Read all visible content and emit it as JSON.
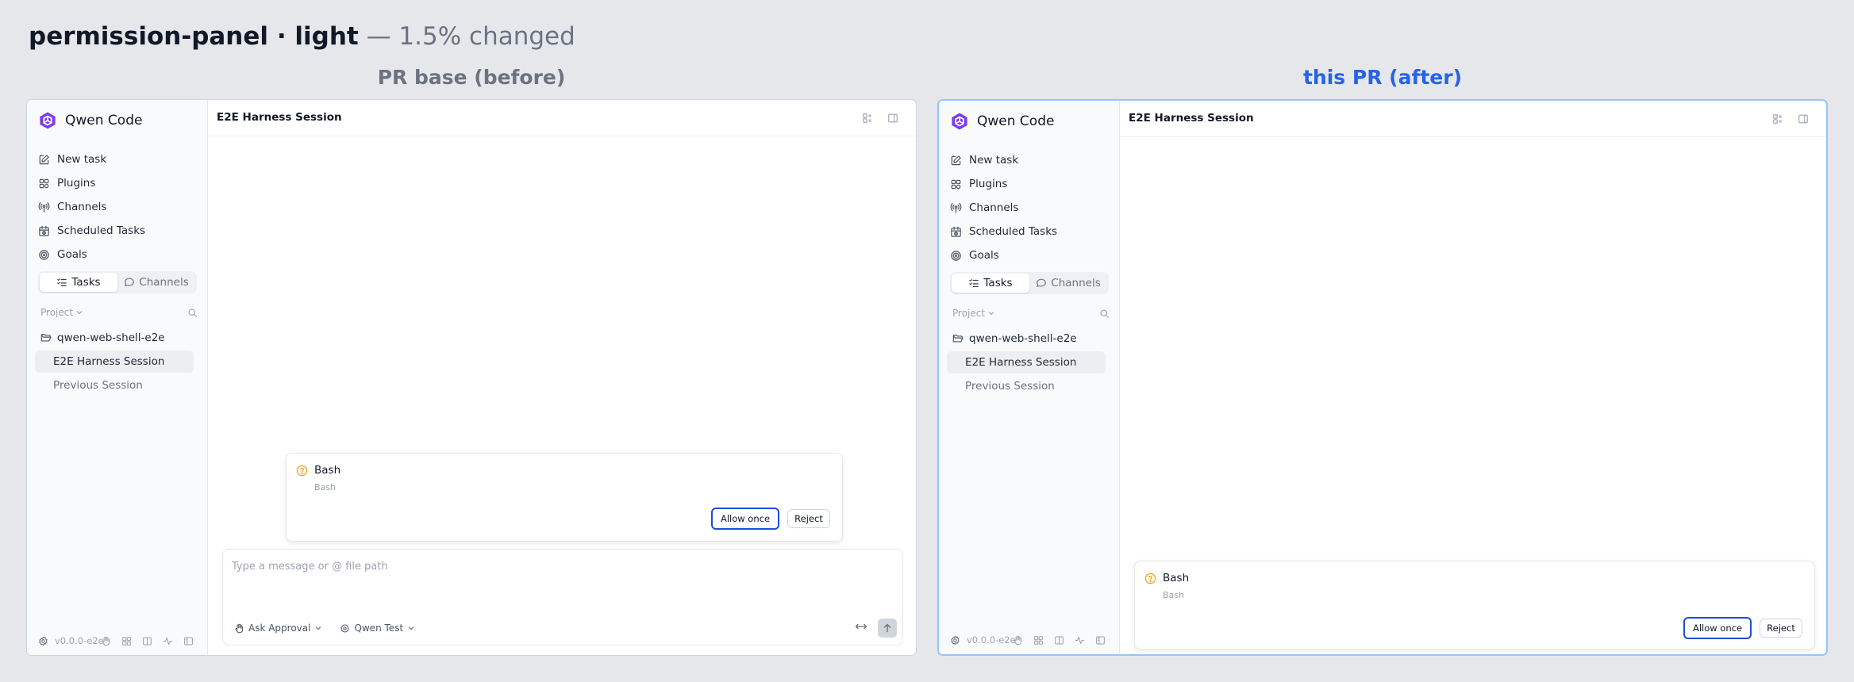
{
  "page_title": {
    "bold": "permission-panel · light",
    "light": " — 1.5% changed"
  },
  "panels": [
    {
      "label": "PR base (before)",
      "app_name": "Qwen Code",
      "nav": [
        "New task",
        "Plugins",
        "Channels",
        "Scheduled Tasks",
        "Goals"
      ],
      "tabs": [
        "Tasks",
        "Channels"
      ],
      "project_label": "Project",
      "folder": "qwen-web-shell-e2e",
      "sessions": [
        "E2E Harness Session",
        "Previous Session"
      ],
      "version": "v0.0.0-e2e",
      "session_title": "E2E Harness Session",
      "permission": {
        "title": "Bash",
        "subtitle": "Bash",
        "allow": "Allow once",
        "reject": "Reject"
      },
      "composer": {
        "placeholder": "Type a message or @ file path",
        "mode": "Ask Approval",
        "model": "Qwen Test"
      }
    },
    {
      "label": "this PR (after)",
      "app_name": "Qwen Code",
      "nav": [
        "New task",
        "Plugins",
        "Channels",
        "Scheduled Tasks",
        "Goals"
      ],
      "tabs": [
        "Tasks",
        "Channels"
      ],
      "project_label": "Project",
      "folder": "qwen-web-shell-e2e",
      "sessions": [
        "E2E Harness Session",
        "Previous Session"
      ],
      "version": "v0.0.0-e2e",
      "session_title": "E2E Harness Session",
      "permission": {
        "title": "Bash",
        "subtitle": "Bash",
        "allow": "Allow once",
        "reject": "Reject"
      }
    }
  ],
  "colors": {
    "accent_after": "#2563eb",
    "muted_before": "#6b7280",
    "allow_border": "#1d4ed8",
    "warning_icon": "#f59e0b",
    "logo": "#7c3aed"
  },
  "icons": {
    "nav": [
      "edit-icon",
      "puzzle-icon",
      "antenna-icon",
      "calendar-clock-icon",
      "target-icon"
    ],
    "tabs": [
      "task-list-icon",
      "chat-bubble-icon"
    ],
    "footer": [
      "settings-gear-icon",
      "hand-icon",
      "grid-icon",
      "book-icon",
      "activity-icon",
      "sidebar-icon"
    ]
  }
}
